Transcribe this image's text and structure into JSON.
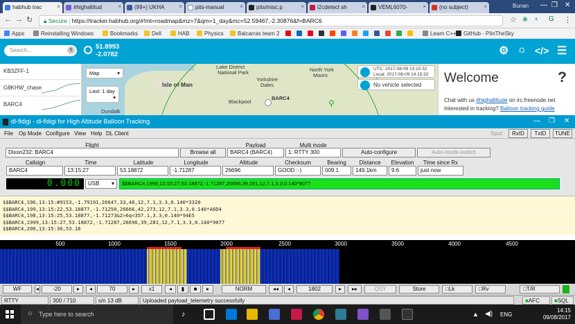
{
  "browser": {
    "tabs": [
      {
        "label": "habhub trac",
        "active": true
      },
      {
        "label": "#highaltitud",
        "active": false
      },
      {
        "label": "(99+) UKHA",
        "active": false
      },
      {
        "label": "pits-manual",
        "active": false
      },
      {
        "label": "pits/misc.p",
        "active": false
      },
      {
        "label": "i2cdetect sh",
        "active": false
      },
      {
        "label": "VEML6070-",
        "active": false
      },
      {
        "label": "(no subject)",
        "active": false
      }
    ],
    "user": "Bunan",
    "secure_label": "Secure",
    "url": "https://tracker.habhub.org/#!mt=roadmap&mz=7&qm=1_day&mc=52.59467,-2.30876&f=BARC6",
    "bookmarks": [
      "Apps",
      "Reinstalling Windows",
      "Bookmarks",
      "Dell",
      "HAB",
      "Physics",
      "Balcarras team 2",
      "Learn C++",
      "GitHub - PiInTheSky"
    ]
  },
  "habhub": {
    "search_placeholder": "Search...",
    "search_count": "5",
    "lat": "51.8993",
    "lon": "-2.0782",
    "map_type": "Map",
    "period": "Last: 1 day",
    "sidebar": [
      "KB3ZFF-1",
      "G8KHW_chase",
      "BARC4"
    ],
    "utc": "UTC: 2017-08-09 13:15:32",
    "local": "Local: 2017-08-09 14:15:32 +1",
    "no_vehicle": "No vehicle selected",
    "map_labels": [
      "Lake District",
      "National Park",
      "Isle of Man",
      "Yorkshire",
      "Dales",
      "North York",
      "Moors",
      "Blackpool",
      "BARC4",
      "Dundalk"
    ],
    "welcome_title": "Welcome",
    "welcome_q": "?",
    "chat_pre": "Chat with us ",
    "chat_link": "#highaltitude",
    "chat_post": " on irc.freenode.net",
    "track_pre": "Interested in tracking? ",
    "track_link": "Balloon tracking guide"
  },
  "fldigi": {
    "title": "dl-fldigi - dl-fldigi for High Altitude Balloon Tracking",
    "menu": [
      "File",
      "Op Mode",
      "Configure",
      "View",
      "Help",
      "DL Client"
    ],
    "right_buttons": [
      "Spot",
      "RxID",
      "TxID",
      "TUNE"
    ],
    "flight_label": "Flight",
    "flight_value": "Dixon232: BARC4",
    "browse_all": "Browse all",
    "payload_label": "Payload",
    "payload_value": "BARC4 (BARC4)",
    "multimode_label": "Multi mode",
    "multimode_value": "1: RTTY 300",
    "auto_configure": "Auto-configure",
    "auto_switch": "Auto-mode-switch",
    "headers": [
      "Callsign",
      "Time",
      "Latitude",
      "Longitude",
      "Altitude",
      "Checksum",
      "Bearing",
      "Distance",
      "Elevation",
      "Time since Rx"
    ],
    "values": [
      "BARC4",
      "13:15:27",
      "53.18872",
      "-1.71287",
      "26696",
      "GOOD :-)",
      "009.1",
      "149.1km",
      "9.6",
      "just now"
    ],
    "freq": "0.000",
    "sideband": "USB",
    "telemetry": "$$BARC4,1999,13:15:27,53.18872,-1.71287,26696,39,281,12,7.1,3.3,0.140*9077",
    "rx_lines": [
      "$$BARC4,196,13:15:#9153,-1.79191,26647,33,48,12,7.1,3.3,0.140*3320",
      "$$BARC4,199,13:15:22,53.18877,-1.71250,26666,42,273,12,7.1,3.3,0.140*A6D4",
      "$$BARC4,198,13:15:25,53.18877,-1.71273&2>6q<357.1,3.3,0.140*94E5",
      "$$BARC4,1999,13:15:27,53.18872,-1.71287,26696,39,281,12,7.1,3.3,0.140*9077",
      "$$BARC4,200,13:15:30,53.18"
    ],
    "scale_ticks": [
      "500",
      "1000",
      "1500",
      "2000",
      "2500",
      "3000",
      "3500",
      "4000",
      "4500"
    ],
    "wf_controls": {
      "wf": "WF",
      "level1": "-20",
      "level2": "70",
      "zoom": "x1",
      "norm": "NORM",
      "carrier": "1802",
      "qsy": "QSY",
      "store": "Store",
      "lk": "Lk",
      "rv": "Rv",
      "tr": "T/R"
    },
    "status": {
      "mode": "RTTY",
      "ratio": "300 / 710",
      "sn": "s/n  13 dB",
      "message": "Uploaded payload_telemetry successfully",
      "afc": "AFC",
      "sql": "SQL"
    }
  },
  "taskbar": {
    "search": "Type here to search",
    "lang": "ENG",
    "time": "14:15",
    "date": "09/08/2017"
  },
  "colors": {
    "habhub": "#00a3d3",
    "fldigi_title": "#009bd0",
    "telemetry_green": "#19e019",
    "rx_bg": "#fff7d6"
  }
}
